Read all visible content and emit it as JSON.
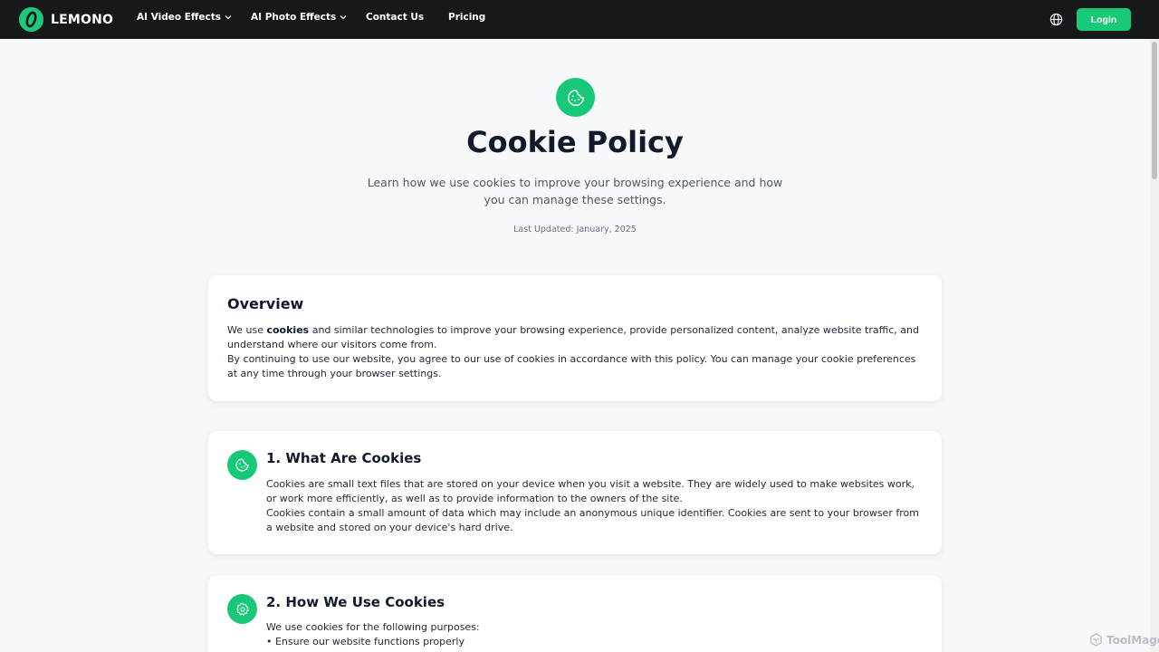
{
  "nav": {
    "brand": "LEMONO",
    "items": [
      {
        "label": "AI Video Effects",
        "dropdown": true
      },
      {
        "label": "AI Photo Effects",
        "dropdown": true
      },
      {
        "label": "Contact Us",
        "dropdown": false
      },
      {
        "label": "Pricing",
        "dropdown": false
      }
    ],
    "language_icon": "globe-icon",
    "login_label": "Login"
  },
  "hero": {
    "icon": "cookie-icon",
    "title": "Cookie Policy",
    "subtitle": "Learn how we use cookies to improve your browsing experience and how you can manage these settings.",
    "last_updated": "Last Updated: January, 2025"
  },
  "overview": {
    "title": "Overview",
    "p1_before": "We use ",
    "p1_bold": "cookies",
    "p1_after": " and similar technologies to improve your browsing experience, provide personalized content, analyze website traffic, and understand where our visitors come from.",
    "p2": "By continuing to use our website, you agree to our use of cookies in accordance with this policy. You can manage your cookie preferences at any time through your browser settings."
  },
  "section1": {
    "icon": "cookie-icon",
    "title": "1. What Are Cookies",
    "p1": "Cookies are small text files that are stored on your device when you visit a website. They are widely used to make websites work, or work more efficiently, as well as to provide information to the owners of the site.",
    "p2": "Cookies contain a small amount of data which may include an anonymous unique identifier. Cookies are sent to your browser from a website and stored on your device's hard drive."
  },
  "section2": {
    "icon": "gear-icon",
    "title": "2. How We Use Cookies",
    "intro": "We use cookies for the following purposes:",
    "bullets": [
      "• Ensure our website functions properly"
    ]
  },
  "watermark": "ToolMage",
  "colors": {
    "accent": "#18c975",
    "navbar_bg": "#16181a",
    "page_bg": "#f7f8fa"
  }
}
